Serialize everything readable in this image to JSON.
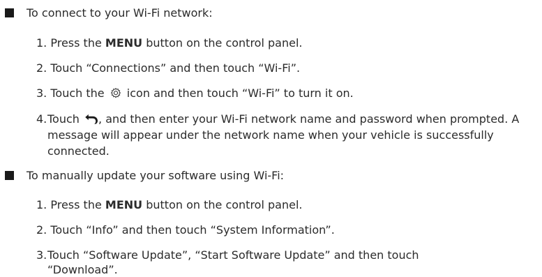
{
  "section1": {
    "heading": "To connect to your Wi-Fi network:",
    "steps": [
      {
        "num": "1.",
        "pre": "Press the ",
        "bold": "MENU",
        "post": " button on the control panel."
      },
      {
        "num": "2.",
        "text": "Touch “Connections” and then touch “Wi-Fi”."
      },
      {
        "num": "3.",
        "pre": "Touch the ",
        "icon": "gear-icon",
        "post": " icon and then touch “Wi-Fi” to turn it on."
      },
      {
        "num": "4.",
        "pre": "Touch ",
        "icon": "back-arrow-icon",
        "post": ", and then enter your Wi-Fi network name and password when prompted. A message will appear under the network name when your vehicle is successfully connected."
      }
    ]
  },
  "section2": {
    "heading": "To manually update your software using Wi-Fi:",
    "steps": [
      {
        "num": "1.",
        "pre": "Press the ",
        "bold": "MENU",
        "post": " button on the control panel."
      },
      {
        "num": "2.",
        "text": "Touch “Info” and then touch “System Information”."
      },
      {
        "num": "3.",
        "text": "Touch “Software Update”, “Start Software Update” and then touch “Download”."
      }
    ]
  }
}
